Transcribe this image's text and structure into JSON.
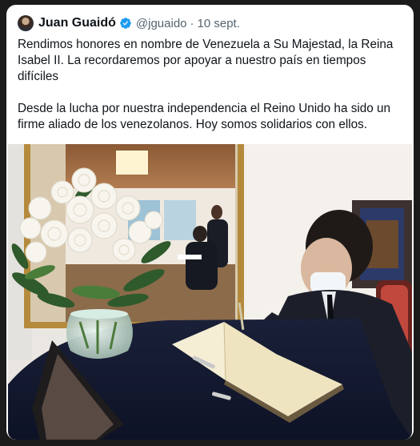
{
  "tweet": {
    "author_name": "Juan Guaidó",
    "handle": "@jguaido",
    "separator": "·",
    "date": "10 sept.",
    "paragraph_1": "Rendimos honores en nombre de Venezuela a Su Majestad, la Reina\nIsabel II. La recordaremos por apoyar a nuestro país en tiempos\ndifíciles",
    "paragraph_2": "Desde la lucha por nuestra independencia el Reino Unido ha sido un\nfirme aliado de los venezolanos. Hoy somos solidarios con ellos."
  },
  "colors": {
    "text": "#0f1419",
    "secondary": "#536471",
    "verified": "#1d9bf0"
  },
  "icons": {
    "verified": "verified-badge-icon",
    "avatar": "avatar"
  }
}
